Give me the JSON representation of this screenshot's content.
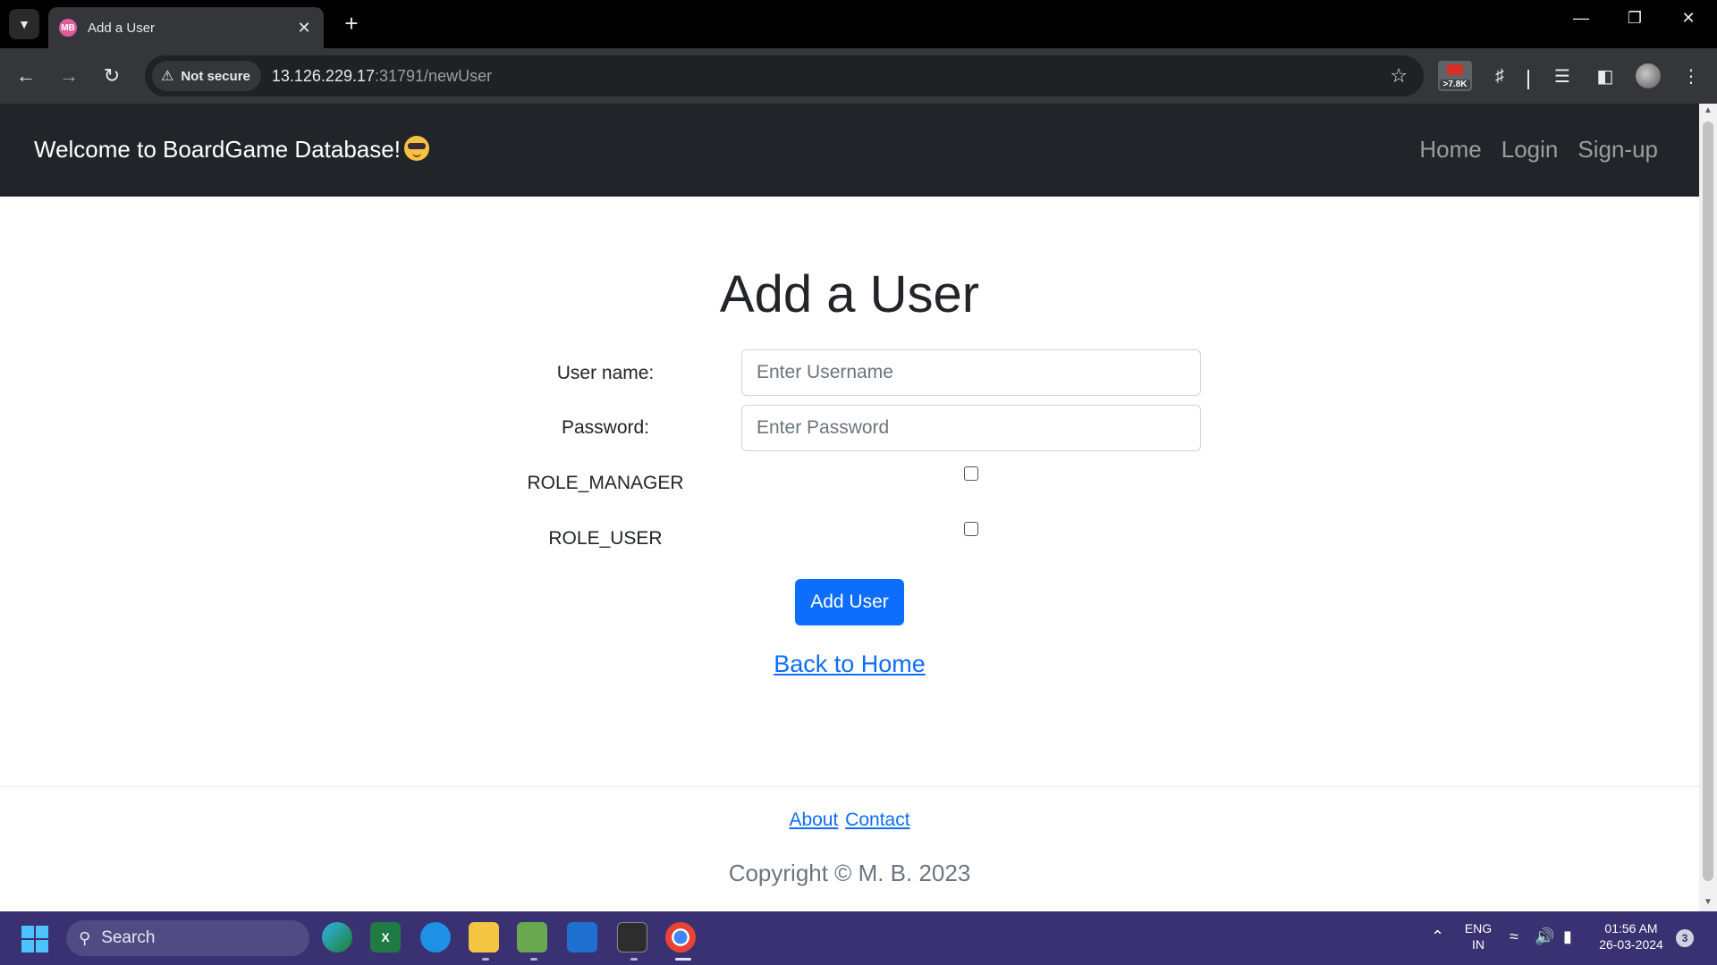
{
  "browser": {
    "tab_title": "Add a User",
    "tab_favicon_text": "MB",
    "security_label": "Not secure",
    "url_host": "13.126.229.17",
    "url_path": ":31791/newUser",
    "extension_badge": ">7.8K"
  },
  "navbar": {
    "brand": "Welcome to BoardGame Database!",
    "links": [
      "Home",
      "Login",
      "Sign-up"
    ]
  },
  "form": {
    "heading": "Add a User",
    "username_label": "User name:",
    "username_placeholder": "Enter Username",
    "password_label": "Password:",
    "password_placeholder": "Enter Password",
    "roles": [
      "ROLE_MANAGER",
      "ROLE_USER"
    ],
    "submit_label": "Add User",
    "back_link": "Back to Home"
  },
  "footer": {
    "about": "About",
    "contact": "Contact",
    "copyright": "Copyright © M. B. 2023"
  },
  "taskbar": {
    "search_placeholder": "Search",
    "language": "ENG",
    "region": "IN",
    "time": "01:56 AM",
    "date": "26-03-2024",
    "notification_count": "3"
  },
  "colors": {
    "navbar_bg": "#212529",
    "primary": "#0d6efd",
    "taskbar_bg": "#3a3172"
  }
}
